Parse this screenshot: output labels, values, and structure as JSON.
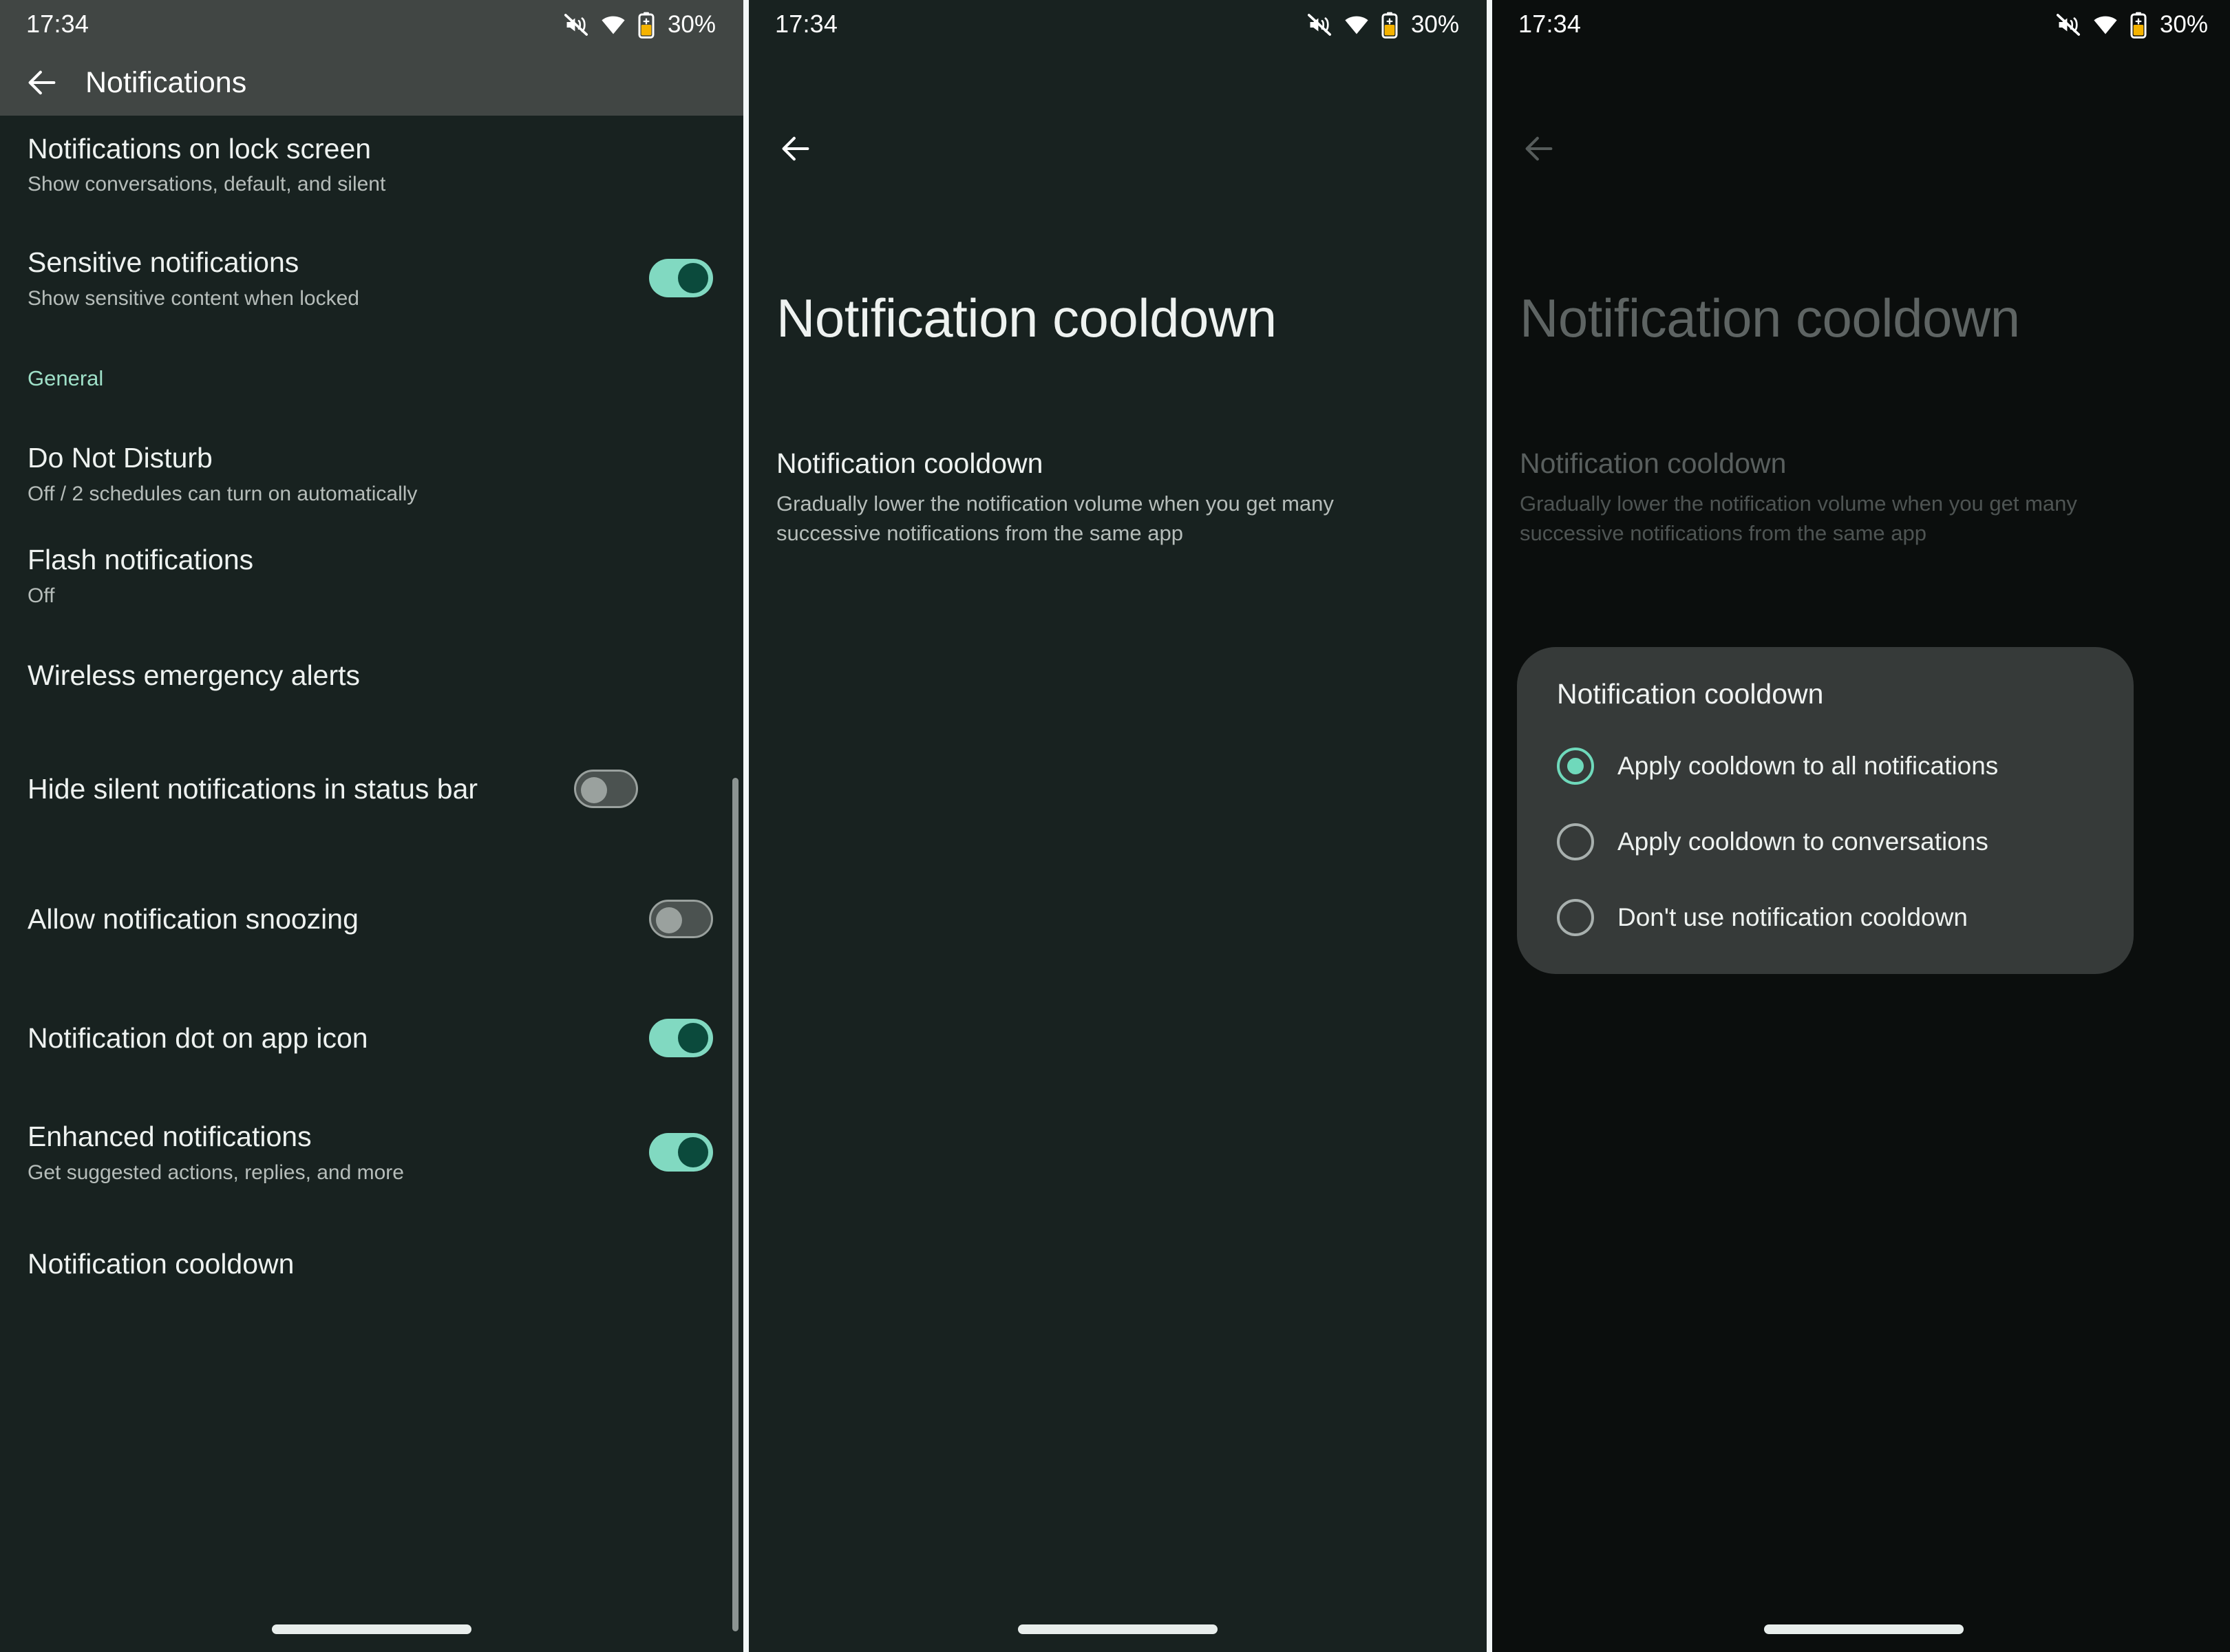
{
  "status_bar": {
    "time": "17:34",
    "battery_text": "30%",
    "icons": [
      "volume-mute-icon",
      "wifi-icon",
      "battery-icon"
    ]
  },
  "colors": {
    "accent_mint": "#81d9c1",
    "accent_thumb_dark": "#0b4a3c",
    "section_header": "#9fe0c8",
    "panel_bg": "#182220",
    "panel_bg_dim": "#0b0e0d",
    "toolbar_bg": "#414644",
    "dialog_bg": "#363a39",
    "battery_icon": "#f5b300"
  },
  "panel1": {
    "toolbar": {
      "back_label": "back-arrow",
      "title": "Notifications"
    },
    "rows": [
      {
        "title": "Notifications on lock screen",
        "sub": "Show conversations, default, and silent",
        "control": "none"
      },
      {
        "title": "Sensitive notifications",
        "sub": "Show sensitive content when locked",
        "control": "switch-on"
      },
      {
        "title": "Do Not Disturb",
        "sub": "Off / 2 schedules can turn on automatically",
        "control": "none"
      },
      {
        "title": "Flash notifications",
        "sub": "Off",
        "control": "none"
      },
      {
        "title": "Wireless emergency alerts",
        "sub": "",
        "control": "none"
      },
      {
        "title": "Hide silent notifications in status bar",
        "sub": "",
        "control": "switch-off"
      },
      {
        "title": "Allow notification snoozing",
        "sub": "",
        "control": "switch-off"
      },
      {
        "title": "Notification dot on app icon",
        "sub": "",
        "control": "switch-on"
      },
      {
        "title": "Enhanced notifications",
        "sub": "Get suggested actions, replies, and more",
        "control": "switch-on"
      },
      {
        "title": "Notification cooldown",
        "sub": "",
        "control": "none"
      }
    ],
    "section_header": "General"
  },
  "panel2": {
    "back_label": "back-arrow",
    "big_title": "Notification cooldown",
    "pref_title": "Notification cooldown",
    "pref_sub": "Gradually lower the notification volume when you get many successive notifications from the same app"
  },
  "panel3": {
    "back_label": "back-arrow",
    "big_title": "Notification cooldown",
    "pref_title": "Notification cooldown",
    "pref_sub": "Gradually lower the notification volume when you get many successive notifications from the same app",
    "dialog": {
      "title": "Notification cooldown",
      "options": [
        {
          "label": "Apply cooldown to all notifications",
          "selected": true
        },
        {
          "label": "Apply cooldown to conversations",
          "selected": false
        },
        {
          "label": "Don't use notification cooldown",
          "selected": false
        }
      ]
    }
  }
}
